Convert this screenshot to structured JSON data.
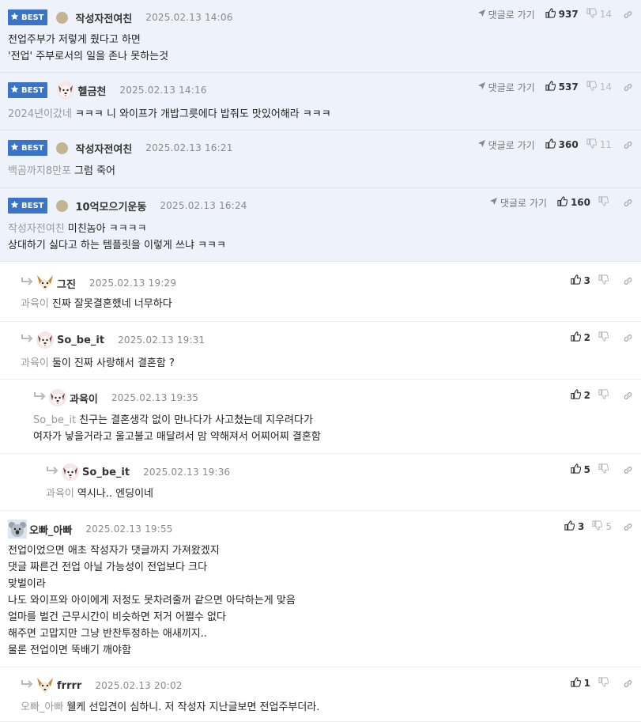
{
  "labels": {
    "best": "BEST",
    "goto": "댓글로 가기"
  },
  "colors": {
    "best_bg": "#eef2fb",
    "badge": "#3a74c9",
    "mention": "#999999",
    "date": "#8a8a8a"
  },
  "comments": [
    {
      "best": true,
      "avatar": "dot",
      "nickname": "작성자전여친",
      "date": "2025.02.13 14:06",
      "mention": "",
      "lines": [
        "전업주부가 저렇게 줬다고 하면",
        "'전업' 주부로서의 일을 존나 못하는것"
      ],
      "up": "937",
      "down": "14",
      "goto": true
    },
    {
      "best": true,
      "avatar": "dog-icon",
      "nickname": "헬금천",
      "date": "2025.02.13 14:16",
      "mention": "2024년이갔네",
      "lines": [
        "ㅋㅋㅋ 니 와이프가 개밥그릇에다 밥줘도 맛있어해라 ㅋㅋㅋ"
      ],
      "up": "537",
      "down": "14",
      "goto": true
    },
    {
      "best": true,
      "avatar": "dot",
      "nickname": "작성자전여친",
      "date": "2025.02.13 16:21",
      "mention": "백곰까지8만포",
      "lines": [
        "그럼 죽어"
      ],
      "up": "360",
      "down": "11",
      "goto": true
    },
    {
      "best": true,
      "avatar": "dot",
      "nickname": "10억모으기운동",
      "date": "2025.02.13 16:24",
      "mention": "작성자전여친",
      "lines": [
        "미친놈아 ㅋㅋㅋㅋ",
        "상대하기 싫다고 하는 템플릿을 이렇게 쓰냐 ㅋㅋㅋ"
      ],
      "up": "160",
      "down": "",
      "goto": true
    },
    {
      "best": false,
      "avatar": "fox-icon",
      "nickname": "그진",
      "date": "2025.02.13 19:29",
      "mention": "과육이",
      "lines": [
        "진짜 잘못결혼했네 너무하다"
      ],
      "up": "3",
      "down": "",
      "goto": false
    },
    {
      "best": false,
      "avatar": "dog-icon",
      "nickname": "So_be_it",
      "date": "2025.02.13 19:31",
      "mention": "과육이",
      "lines": [
        "둘이 진짜 사랑해서 결혼함 ?"
      ],
      "up": "2",
      "down": "",
      "goto": false
    },
    {
      "best": false,
      "avatar": "dog-icon",
      "nickname": "과육이",
      "date": "2025.02.13 19:35",
      "mention": "So_be_it",
      "lines": [
        "친구는 결혼생각 없이 만나다가 사고쳤는데 지우려다가",
        "여자가 낳을거라고 울고불고 매달려서 맘 약해져서 어찌어찌 결혼함"
      ],
      "up": "2",
      "down": "",
      "goto": false
    },
    {
      "best": false,
      "avatar": "dog-icon",
      "nickname": "So_be_it",
      "date": "2025.02.13 19:36",
      "mention": "과육이",
      "lines": [
        "역시나.. 엔딩이네"
      ],
      "up": "5",
      "down": "",
      "goto": false
    },
    {
      "best": false,
      "avatar": "koala-icon",
      "nickname": "오빠_아빠",
      "date": "2025.02.13 19:55",
      "mention": "",
      "lines": [
        "전업이었으면 애초 작성자가 댓글까지 가져왔겠지",
        "댓글 짜른건 전업 아닐 가능성이 전업보다 크다",
        "맞벌이라",
        "나도 와이프와 아이에게 저정도 못차려줄꺼 같으면 아닥하는게 맞음",
        "얼마를 벌건 근무시간이 비슷하면 저거 어쩔수 없다",
        "해주면 고맙지만 그냥 반찬투정하는 애새끼지..",
        "물론 전업이면 뚝배기 깨야함"
      ],
      "up": "3",
      "down": "5",
      "goto": false
    },
    {
      "best": false,
      "avatar": "fox-icon",
      "nickname": "frrrr",
      "date": "2025.02.13 20:02",
      "mention": "오빠_아빠",
      "lines": [
        "웰케 선입견이 심하니. 저 작성자 지난글보면 전업주부더라."
      ],
      "up": "1",
      "down": "",
      "goto": false
    }
  ]
}
